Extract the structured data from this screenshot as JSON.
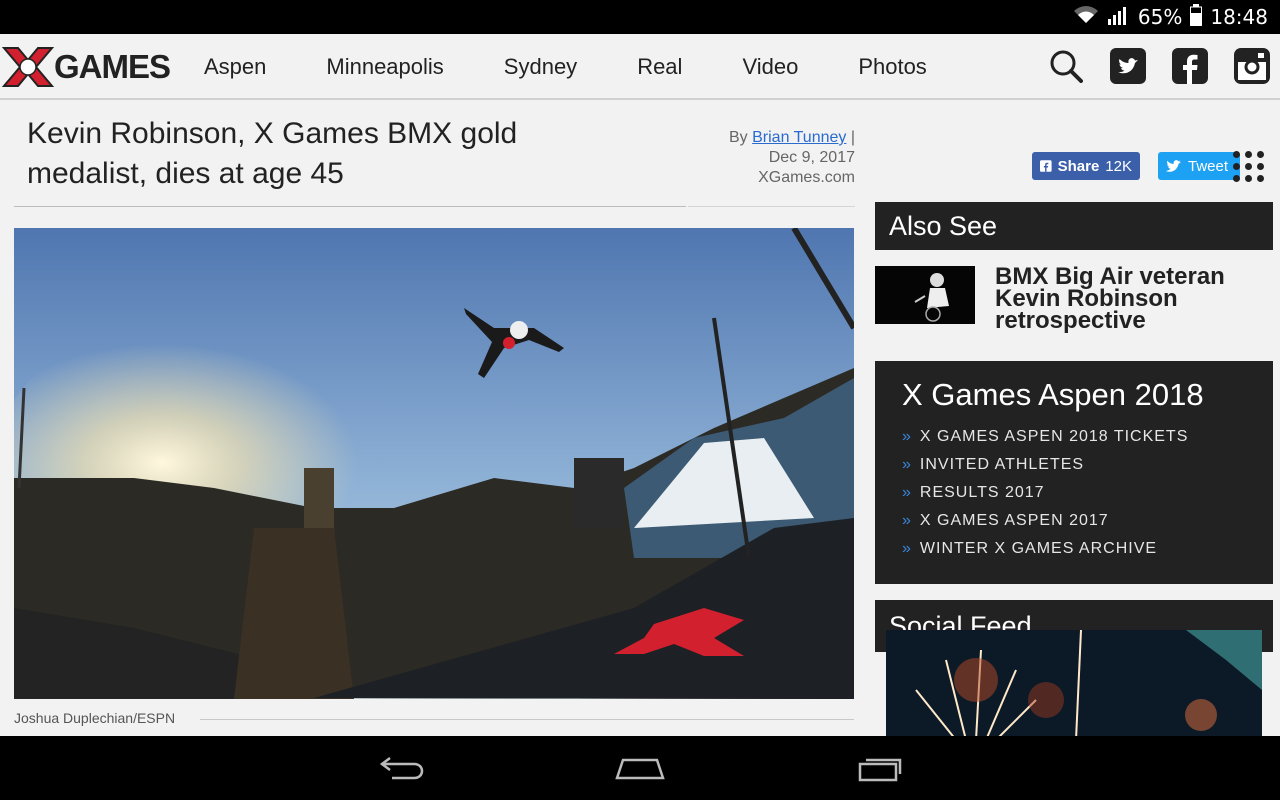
{
  "status_bar": {
    "battery": "65%",
    "time": "18:48",
    "icons": [
      "wifi-icon",
      "signal-icon",
      "battery-icon"
    ]
  },
  "nav": {
    "logo_text": "GAMES",
    "links": [
      "Aspen",
      "Minneapolis",
      "Sydney",
      "Real",
      "Video",
      "Photos"
    ],
    "icons": [
      "search-icon",
      "twitter-icon",
      "facebook-icon",
      "instagram-icon"
    ]
  },
  "article": {
    "headline": "Kevin Robinson, X Games BMX gold medalist, dies at age 45",
    "byline_prefix": "By",
    "author": "Brian Tunney",
    "byline_sep": "|",
    "date": "Dec 9, 2017",
    "source": "XGames.com",
    "photo_caption": "Joshua Duplechian/ESPN"
  },
  "share": {
    "facebook_label": "Share",
    "facebook_count": "12K",
    "twitter_label": "Tweet"
  },
  "also_see": {
    "heading": "Also See",
    "item_title": "BMX Big Air veteran Kevin Robinson retrospective"
  },
  "aspen_box": {
    "title": "X Games Aspen 2018",
    "links": [
      "X GAMES ASPEN 2018 TICKETS",
      "INVITED ATHLETES",
      "RESULTS 2017",
      "X GAMES ASPEN 2017",
      "WINTER X GAMES ARCHIVE"
    ]
  },
  "social_feed": {
    "heading": "Social Feed"
  },
  "colors": {
    "link_blue": "#2a6bd0",
    "facebook": "#3b5fa8",
    "twitter": "#1da1f2",
    "logo_red": "#d3202f",
    "dark_box": "#222222"
  },
  "system_nav": [
    "back-icon",
    "home-icon",
    "recents-icon"
  ]
}
